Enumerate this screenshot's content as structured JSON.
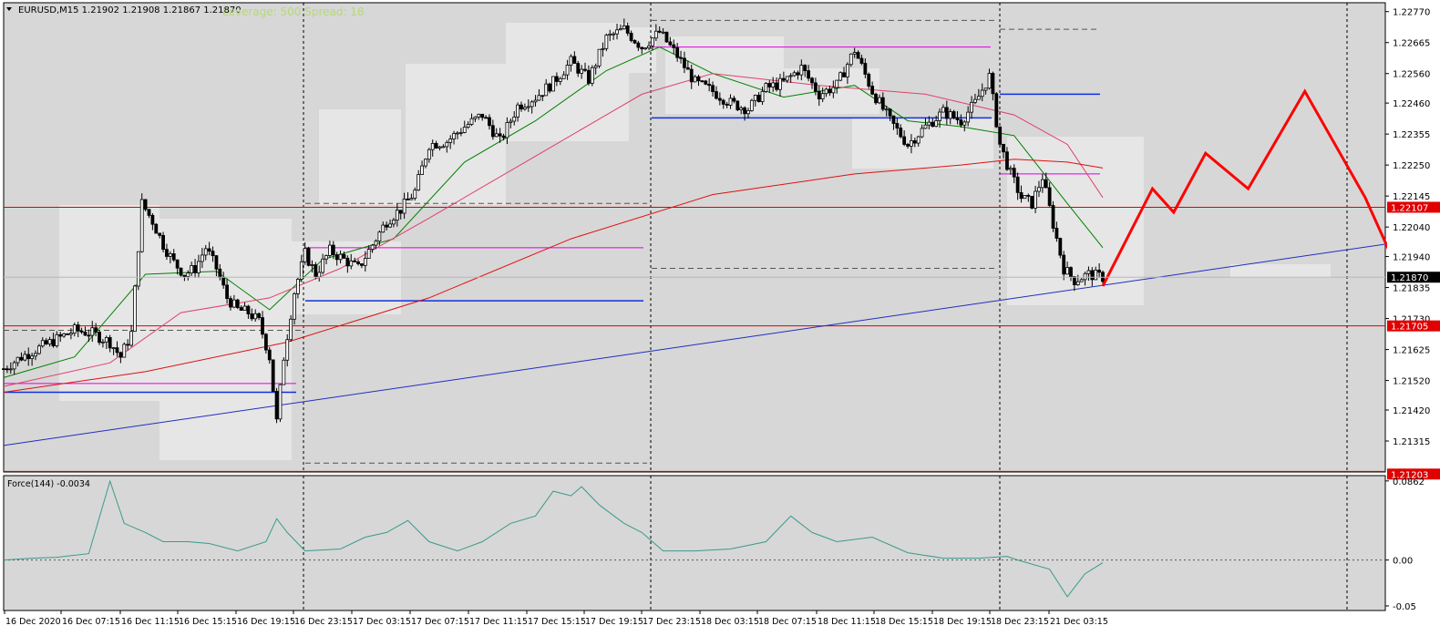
{
  "header": {
    "symbol_line": "EURUSD,M15  1.21902 1.21908 1.21867 1.21870",
    "overlay": "Leverage: 500 Spread: 18"
  },
  "indicator": {
    "label": "Force(144) -0.0034"
  },
  "colors": {
    "bg": "#d7d7d7",
    "block": "#e6e6e6",
    "candle": "#000000",
    "grid": "#000000",
    "sma_fast": "#008000",
    "sma_mid": "#e0406a",
    "sma_slow": "#e01010",
    "trend": "#1f2fbf",
    "level_red": "#e00000",
    "level_blue": "#1030e0",
    "level_magenta": "#e000e0",
    "forecast": "#ff0000",
    "force": "#3a9a8a"
  },
  "chart_data": {
    "type": "candlestick",
    "symbol": "EURUSD",
    "timeframe": "M15",
    "ohlc_last": {
      "open": 1.21902,
      "high": 1.21908,
      "low": 1.21867,
      "close": 1.2187
    },
    "ylim": [
      1.2121,
      1.228
    ],
    "x_tick_labels": [
      "16 Dec 2020",
      "16 Dec 07:15",
      "16 Dec 11:15",
      "16 Dec 15:15",
      "16 Dec 19:15",
      "16 Dec 23:15",
      "17 Dec 03:15",
      "17 Dec 07:15",
      "17 Dec 11:15",
      "17 Dec 15:15",
      "17 Dec 19:15",
      "17 Dec 23:15",
      "18 Dec 03:15",
      "18 Dec 07:15",
      "18 Dec 11:15",
      "18 Dec 15:15",
      "18 Dec 19:15",
      "18 Dec 23:15",
      "21 Dec 03:15"
    ],
    "y_tick_labels": [
      "1.22770",
      "1.22665",
      "1.22560",
      "1.22460",
      "1.22355",
      "1.22250",
      "1.22145",
      "1.22040",
      "1.21940",
      "1.21835",
      "1.21730",
      "1.21625",
      "1.21520",
      "1.21420",
      "1.21315"
    ],
    "y_tick_values": [
      1.2277,
      1.22665,
      1.2256,
      1.2246,
      1.22355,
      1.2225,
      1.22145,
      1.2204,
      1.2194,
      1.21835,
      1.2173,
      1.21625,
      1.2152,
      1.2142,
      1.21315
    ],
    "price_tags": [
      {
        "label": "1.22107",
        "value": 1.22107,
        "kind": "level"
      },
      {
        "label": "1.21870",
        "value": 1.2187,
        "kind": "current"
      },
      {
        "label": "1.21705",
        "value": 1.21705,
        "kind": "level"
      },
      {
        "label": "1.21203",
        "value": 1.21203,
        "kind": "level"
      }
    ],
    "close_path": [
      [
        0,
        1.2156
      ],
      [
        5,
        1.216
      ],
      [
        10,
        1.2163
      ],
      [
        15,
        1.2166
      ],
      [
        20,
        1.2169
      ],
      [
        25,
        1.2168
      ],
      [
        30,
        1.2165
      ],
      [
        33,
        1.216
      ],
      [
        36,
        1.2168
      ],
      [
        39,
        1.2212
      ],
      [
        42,
        1.2206
      ],
      [
        45,
        1.2198
      ],
      [
        48,
        1.2192
      ],
      [
        51,
        1.2188
      ],
      [
        54,
        1.219
      ],
      [
        57,
        1.2197
      ],
      [
        60,
        1.219
      ],
      [
        63,
        1.218
      ],
      [
        66,
        1.2176
      ],
      [
        69,
        1.2175
      ],
      [
        72,
        1.2172
      ],
      [
        75,
        1.216
      ],
      [
        77,
        1.2138
      ],
      [
        79,
        1.216
      ],
      [
        82,
        1.2182
      ],
      [
        85,
        1.2195
      ],
      [
        88,
        1.2188
      ],
      [
        92,
        1.2196
      ],
      [
        96,
        1.2193
      ],
      [
        100,
        1.219
      ],
      [
        104,
        1.2198
      ],
      [
        108,
        1.2206
      ],
      [
        112,
        1.221
      ],
      [
        116,
        1.2216
      ],
      [
        120,
        1.2232
      ],
      [
        125,
        1.2233
      ],
      [
        130,
        1.2238
      ],
      [
        135,
        1.2242
      ],
      [
        140,
        1.2233
      ],
      [
        145,
        1.2245
      ],
      [
        150,
        1.2248
      ],
      [
        155,
        1.2253
      ],
      [
        160,
        1.226
      ],
      [
        165,
        1.2254
      ],
      [
        170,
        1.2268
      ],
      [
        175,
        1.2271
      ],
      [
        180,
        1.2265
      ],
      [
        185,
        1.227
      ],
      [
        190,
        1.2262
      ],
      [
        195,
        1.2253
      ],
      [
        200,
        1.225
      ],
      [
        205,
        1.2246
      ],
      [
        210,
        1.2244
      ],
      [
        215,
        1.2251
      ],
      [
        220,
        1.2253
      ],
      [
        225,
        1.2258
      ],
      [
        230,
        1.2249
      ],
      [
        235,
        1.2252
      ],
      [
        240,
        1.2264
      ],
      [
        245,
        1.225
      ],
      [
        250,
        1.224
      ],
      [
        255,
        1.2232
      ],
      [
        260,
        1.2238
      ],
      [
        265,
        1.2243
      ],
      [
        270,
        1.224
      ],
      [
        274,
        1.2246
      ],
      [
        278,
        1.2255
      ],
      [
        281,
        1.2232
      ],
      [
        284,
        1.2222
      ],
      [
        287,
        1.2214
      ],
      [
        290,
        1.2212
      ],
      [
        293,
        1.2221
      ],
      [
        296,
        1.2205
      ],
      [
        299,
        1.219
      ],
      [
        302,
        1.2186
      ],
      [
        306,
        1.2188
      ],
      [
        310,
        1.2187
      ]
    ],
    "series": [
      {
        "kind": "sma_fast",
        "values": [
          [
            0,
            1.2153
          ],
          [
            20,
            1.216
          ],
          [
            40,
            1.2188
          ],
          [
            60,
            1.2189
          ],
          [
            75,
            1.2176
          ],
          [
            90,
            1.2193
          ],
          [
            110,
            1.22
          ],
          [
            130,
            1.2226
          ],
          [
            150,
            1.224
          ],
          [
            170,
            1.2257
          ],
          [
            185,
            1.2265
          ],
          [
            200,
            1.2256
          ],
          [
            220,
            1.2248
          ],
          [
            240,
            1.2252
          ],
          [
            255,
            1.224
          ],
          [
            270,
            1.2238
          ],
          [
            285,
            1.2235
          ],
          [
            300,
            1.2212
          ],
          [
            310,
            1.2197
          ]
        ]
      },
      {
        "kind": "sma_mid",
        "values": [
          [
            0,
            1.215
          ],
          [
            30,
            1.2158
          ],
          [
            50,
            1.2175
          ],
          [
            75,
            1.218
          ],
          [
            95,
            1.219
          ],
          [
            120,
            1.2207
          ],
          [
            150,
            1.2228
          ],
          [
            180,
            1.2249
          ],
          [
            200,
            1.2256
          ],
          [
            230,
            1.2252
          ],
          [
            260,
            1.2249
          ],
          [
            285,
            1.2242
          ],
          [
            300,
            1.2232
          ],
          [
            310,
            1.2214
          ]
        ]
      },
      {
        "kind": "sma_slow",
        "values": [
          [
            0,
            1.2148
          ],
          [
            40,
            1.2155
          ],
          [
            80,
            1.2165
          ],
          [
            120,
            1.218
          ],
          [
            160,
            1.22
          ],
          [
            200,
            1.2215
          ],
          [
            240,
            1.2222
          ],
          [
            270,
            1.2225
          ],
          [
            285,
            1.2227
          ],
          [
            300,
            1.2226
          ],
          [
            310,
            1.2224
          ]
        ]
      }
    ],
    "trendline": [
      [
        0,
        1.213
      ],
      [
        400,
        1.22
      ]
    ],
    "forecast": [
      [
        310,
        1.2184
      ],
      [
        324,
        1.2217
      ],
      [
        330,
        1.2209
      ],
      [
        339,
        1.2229
      ],
      [
        351,
        1.2217
      ],
      [
        367,
        1.225
      ],
      [
        384,
        1.2214
      ],
      [
        393,
        1.219
      ]
    ],
    "force": {
      "label": "Force(144)",
      "value": -0.0034,
      "ylim": [
        -0.055,
        0.092
      ],
      "tick_labels": [
        "0.0862",
        "0.00",
        "-0.05"
      ],
      "tick_values": [
        0.0862,
        0.0,
        -0.05
      ],
      "values": [
        [
          0,
          0.0
        ],
        [
          8,
          0.002
        ],
        [
          15,
          0.003
        ],
        [
          24,
          0.007
        ],
        [
          30,
          0.086
        ],
        [
          34,
          0.04
        ],
        [
          40,
          0.03
        ],
        [
          45,
          0.02
        ],
        [
          52,
          0.02
        ],
        [
          58,
          0.018
        ],
        [
          66,
          0.01
        ],
        [
          74,
          0.02
        ],
        [
          77,
          0.045
        ],
        [
          80,
          0.03
        ],
        [
          85,
          0.01
        ],
        [
          95,
          0.012
        ],
        [
          102,
          0.025
        ],
        [
          108,
          0.03
        ],
        [
          114,
          0.043
        ],
        [
          120,
          0.02
        ],
        [
          128,
          0.01
        ],
        [
          135,
          0.02
        ],
        [
          143,
          0.04
        ],
        [
          150,
          0.048
        ],
        [
          155,
          0.075
        ],
        [
          160,
          0.07
        ],
        [
          163,
          0.08
        ],
        [
          168,
          0.06
        ],
        [
          175,
          0.04
        ],
        [
          180,
          0.03
        ],
        [
          186,
          0.01
        ],
        [
          195,
          0.01
        ],
        [
          205,
          0.012
        ],
        [
          215,
          0.02
        ],
        [
          222,
          0.048
        ],
        [
          228,
          0.03
        ],
        [
          235,
          0.02
        ],
        [
          245,
          0.025
        ],
        [
          255,
          0.008
        ],
        [
          265,
          0.002
        ],
        [
          275,
          0.002
        ],
        [
          283,
          0.004
        ],
        [
          286,
          0.0
        ],
        [
          295,
          -0.01
        ],
        [
          300,
          -0.04
        ],
        [
          305,
          -0.015
        ],
        [
          310,
          -0.003
        ]
      ]
    }
  }
}
